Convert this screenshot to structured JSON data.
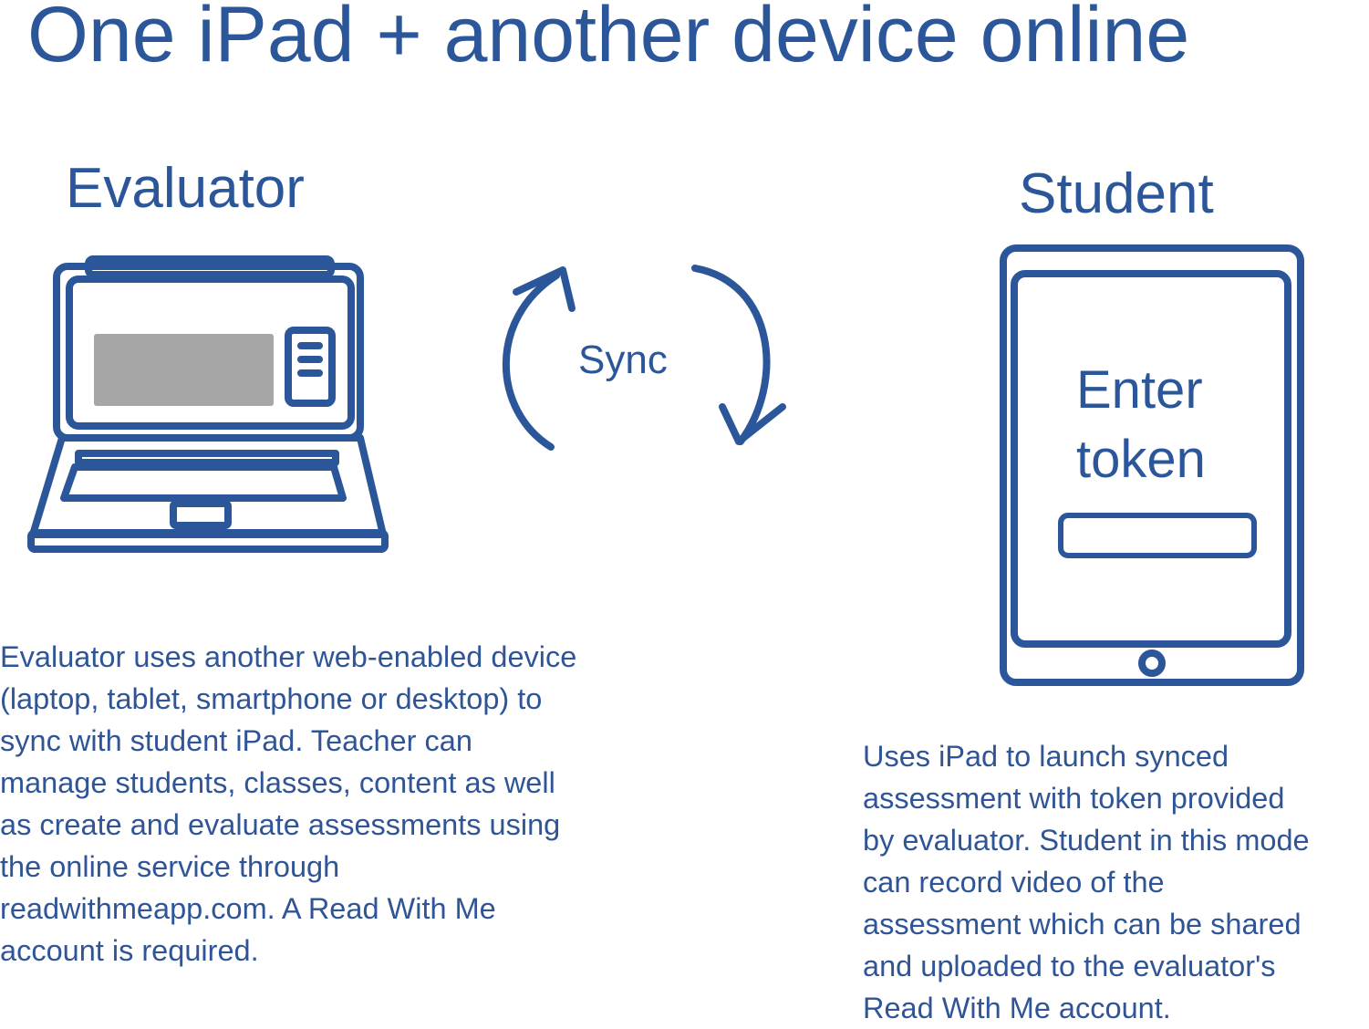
{
  "title": "One iPad + another device online",
  "evaluator": {
    "heading": "Evaluator",
    "description_lines": [
      "Evaluator uses another web-enabled device",
      "(laptop, tablet, smartphone or desktop) to",
      "sync with student iPad. Teacher can",
      "manage students, classes, content as well",
      "as create and evaluate assessments using",
      "the online service through",
      "readwithmeapp.com. A Read With Me",
      "account is required."
    ]
  },
  "sync": {
    "label": "Sync"
  },
  "student": {
    "heading": "Student",
    "token_prompt_lines": [
      "Enter",
      "token"
    ],
    "description_lines": [
      "Uses iPad to launch synced",
      "assessment with token provided",
      "by evaluator. Student in this mode",
      "can record video of the",
      "assessment which can be shared",
      "and uploaded to the evaluator's",
      "Read With Me account."
    ]
  },
  "icons": {
    "laptop": "laptop-icon",
    "tablet": "tablet-icon",
    "sync_arrows": "sync-arrows-icon"
  },
  "colors": {
    "primary": "#2b579a",
    "screen_block": "#a6a6a6",
    "background": "#ffffff"
  }
}
